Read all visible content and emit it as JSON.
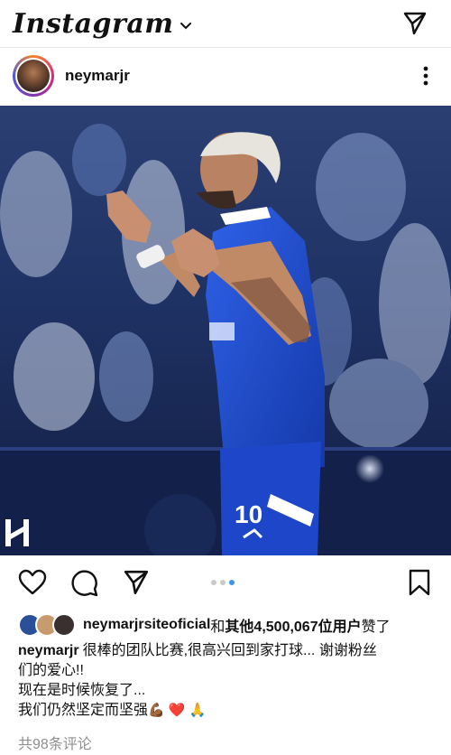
{
  "header": {
    "app_title": "Instagram"
  },
  "post": {
    "username": "neymarjr",
    "likes": {
      "liker": "neymarjrsiteoficial",
      "joiner": "和",
      "others": "其他4,500,067位用户",
      "suffix": "赞了"
    },
    "caption": {
      "author": "neymarjr",
      "line1": "很棒的团队比赛,很高兴回到家打球... 谢谢粉丝",
      "line2": "们的爱心!!",
      "line3": "现在是时候恢复了...",
      "line4": "我们仍然坚定而坚强",
      "emojis": "💪🏾 ❤️ 🙏"
    },
    "comments_label": "共98条评论",
    "jersey_number": "10",
    "carousel": {
      "count": 3,
      "active_index": 2
    }
  },
  "icons": [
    "chevron-down-icon",
    "direct-message-icon",
    "more-options-icon",
    "heart-icon",
    "comment-icon",
    "share-icon",
    "bookmark-icon"
  ],
  "colors": {
    "accent": "#3897f0",
    "jersey": "#1f4fcf",
    "background": "#ffffff",
    "muted_text": "#8e8e8e"
  }
}
